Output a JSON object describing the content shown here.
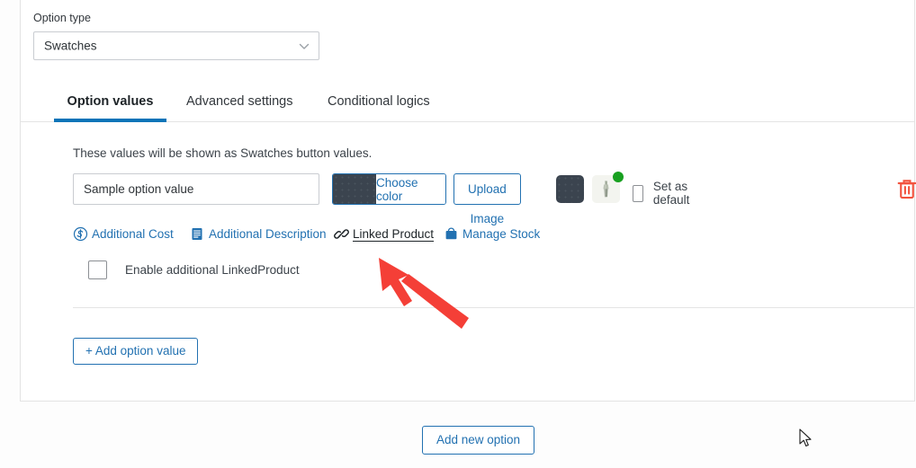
{
  "option_type": {
    "label": "Option type",
    "value": "Swatches",
    "chevron_icon": "chevron-down-icon"
  },
  "tabs": [
    {
      "label": "Option values",
      "active": true
    },
    {
      "label": "Advanced settings",
      "active": false
    },
    {
      "label": "Conditional logics",
      "active": false
    }
  ],
  "panel": {
    "hint": "These values will be shown as Swatches button values.",
    "value_row": {
      "option_value": "Sample option value",
      "option_value_placeholder": "Sample option value",
      "choose_color_label": "Choose color",
      "choose_color_swatch_hex": "#3b444f",
      "upload_image_label": "Upload Image",
      "dark_swatch_hex": "#3b444f",
      "thumbnail_badge_hex": "#18a020",
      "set_as_default_label": "Set as default",
      "set_as_default_checked": false,
      "delete_icon": "trash-icon",
      "delete_icon_hex": "#f2533f"
    },
    "links": [
      {
        "label": "Additional Cost",
        "icon": "dollar-circle-icon",
        "active": false
      },
      {
        "label": "Additional Description",
        "icon": "list-lines-icon",
        "active": false
      },
      {
        "label": "Linked Product",
        "icon": "chain-link-icon",
        "active": true
      },
      {
        "label": "Manage Stock",
        "icon": "shopping-bag-icon",
        "active": false
      }
    ],
    "enable_additional": {
      "label": "Enable additional LinkedProduct",
      "checked": false
    },
    "add_option_value_label": "+ Add option value"
  },
  "footer": {
    "add_new_option_label": "Add new option"
  },
  "annotation": {
    "arrow_color": "#f43f37",
    "points_to": "Linked Product"
  },
  "colors": {
    "accent_blue": "#2271b1",
    "tab_underline": "#0a74b8",
    "text": "#3c434a"
  }
}
